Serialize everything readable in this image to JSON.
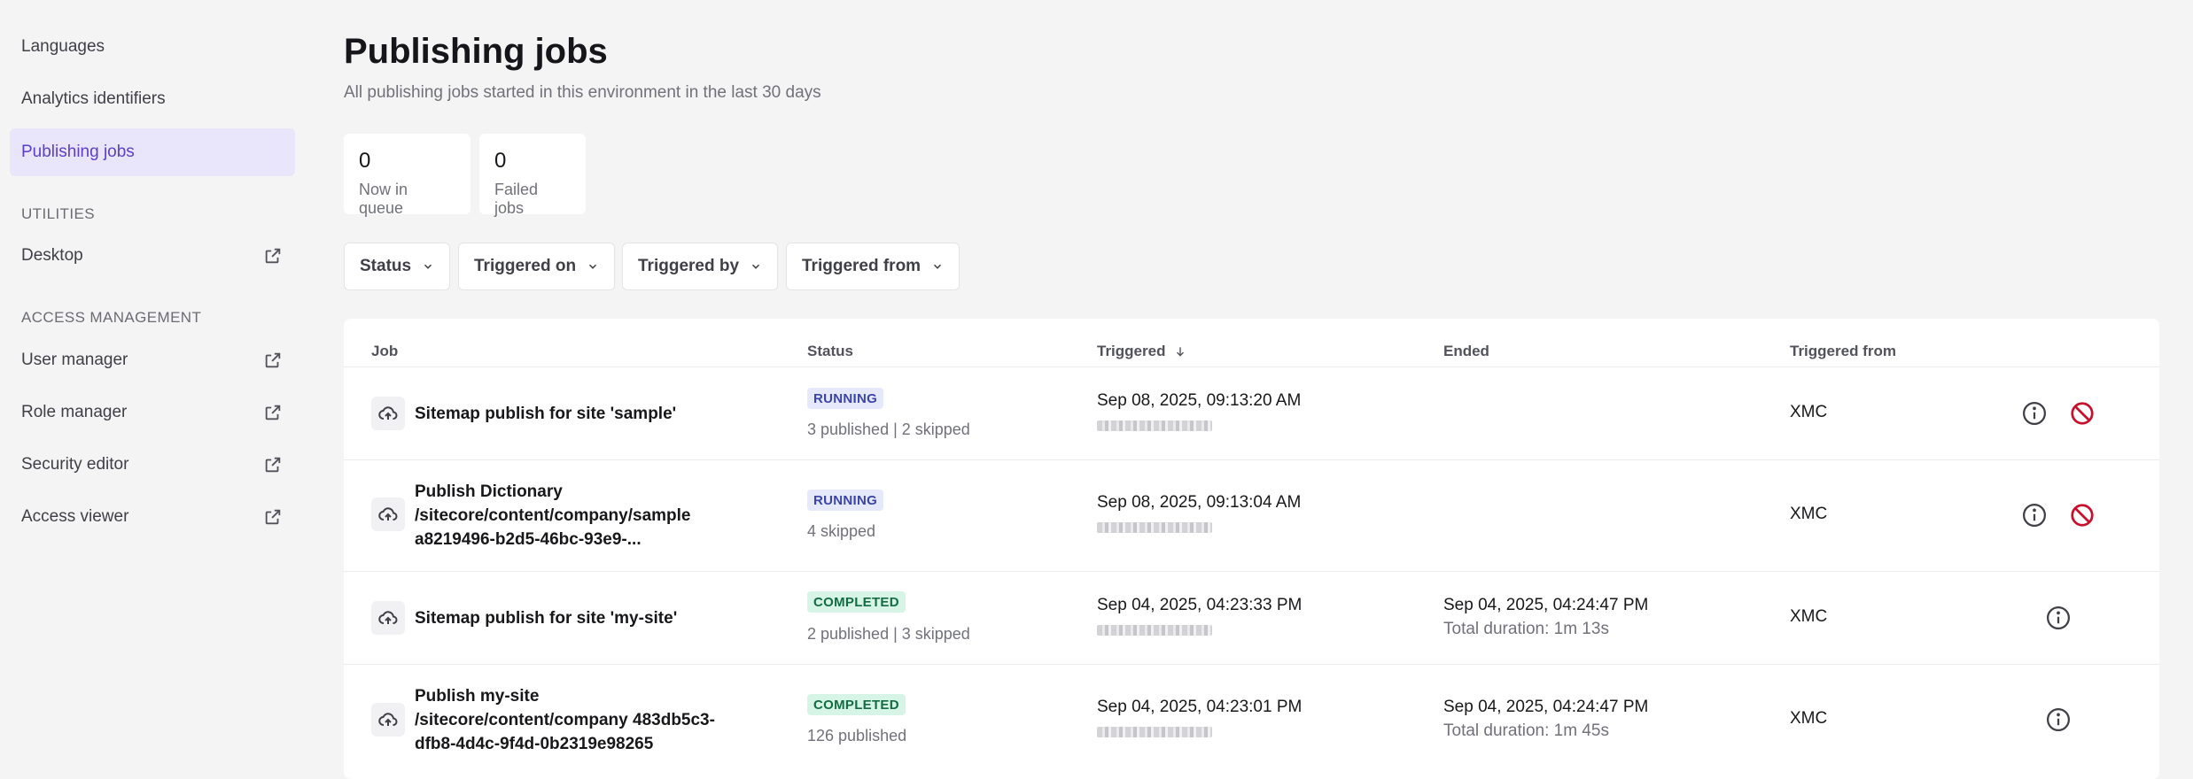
{
  "sidebar": {
    "items": [
      {
        "label": "Languages"
      },
      {
        "label": "Analytics identifiers"
      },
      {
        "label": "Publishing jobs"
      }
    ],
    "utilities_label": "UTILITIES",
    "utilities": [
      {
        "label": "Desktop",
        "icon": "external-link-icon"
      }
    ],
    "access_label": "ACCESS MANAGEMENT",
    "access": [
      {
        "label": "User manager",
        "icon": "external-link-icon"
      },
      {
        "label": "Role manager",
        "icon": "external-link-icon"
      },
      {
        "label": "Security editor",
        "icon": "external-link-icon"
      },
      {
        "label": "Access viewer",
        "icon": "external-link-icon"
      }
    ]
  },
  "header": {
    "title": "Publishing jobs",
    "subtitle": "All publishing jobs started in this environment in the last 30 days"
  },
  "stats": [
    {
      "value": "0",
      "label": "Now in queue"
    },
    {
      "value": "0",
      "label": "Failed jobs"
    }
  ],
  "filters": [
    {
      "label": "Status"
    },
    {
      "label": "Triggered on"
    },
    {
      "label": "Triggered by"
    },
    {
      "label": "Triggered from"
    }
  ],
  "table": {
    "columns": {
      "job": "Job",
      "status": "Status",
      "triggered": "Triggered",
      "ended": "Ended",
      "from": "Triggered from"
    },
    "rows": [
      {
        "job_lines": [
          "Sitemap publish for site 'sample'"
        ],
        "status": "RUNNING",
        "status_sub": "3 published | 2 skipped",
        "triggered": "Sep 08, 2025, 09:13:20 AM",
        "ended": "",
        "ended_sub": "",
        "from": "XMC"
      },
      {
        "job_lines": [
          "Publish Dictionary",
          "/sitecore/content/company/sample",
          "a8219496-b2d5-46bc-93e9-..."
        ],
        "status": "RUNNING",
        "status_sub": "4 skipped",
        "triggered": "Sep 08, 2025, 09:13:04 AM",
        "ended": "",
        "ended_sub": "",
        "from": "XMC"
      },
      {
        "job_lines": [
          "Sitemap publish for site 'my-site'"
        ],
        "status": "COMPLETED",
        "status_sub": "2 published | 3 skipped",
        "triggered": "Sep 04, 2025, 04:23:33 PM",
        "ended": "Sep 04, 2025, 04:24:47 PM",
        "ended_sub": "Total duration: 1m 13s",
        "from": "XMC"
      },
      {
        "job_lines": [
          "Publish my-site",
          "/sitecore/content/company 483db5c3-",
          "dfb8-4d4c-9f4d-0b2319e98265"
        ],
        "status": "COMPLETED",
        "status_sub": "126 published",
        "triggered": "Sep 04, 2025, 04:23:01 PM",
        "ended": "Sep 04, 2025, 04:24:47 PM",
        "ended_sub": "Total duration: 1m 45s",
        "from": "XMC"
      }
    ]
  },
  "colors": {
    "accent": "#5b3fc8",
    "cancel": "#c8102e",
    "running_badge": "#e6e9fb",
    "completed_badge": "#d6f5e6"
  }
}
